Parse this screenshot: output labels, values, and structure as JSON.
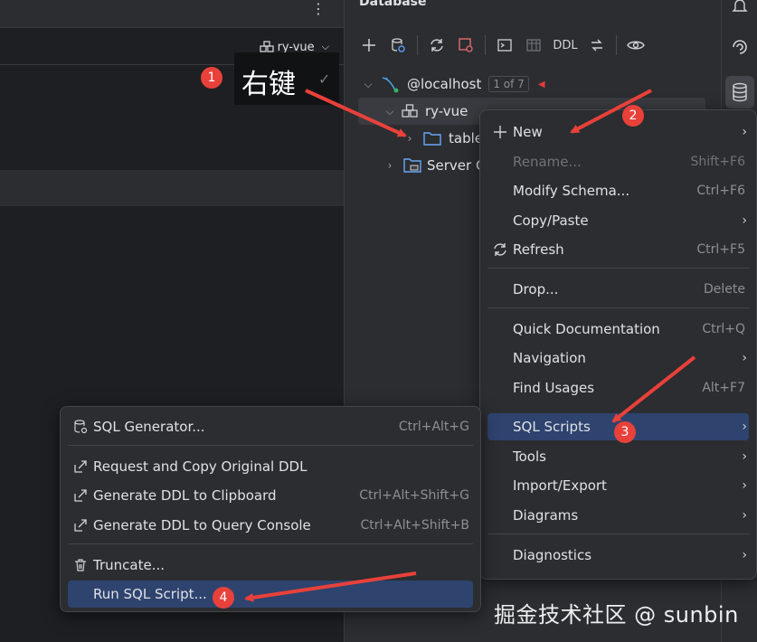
{
  "left": {
    "schema_label": "ry-vue",
    "dots": "⋮"
  },
  "db_panel": {
    "title": "Database",
    "toolbar": {
      "ddl_label": "DDL"
    }
  },
  "tree": {
    "host": "@localhost",
    "host_count": "1 of 7",
    "schema": "ry-vue",
    "tables": "table",
    "server": "Server C"
  },
  "main_menu": {
    "items": [
      {
        "label": "New",
        "shortcut": "",
        "submenu": true,
        "disabled": false
      },
      {
        "label": "Rename...",
        "shortcut": "Shift+F6",
        "submenu": false,
        "disabled": true
      },
      {
        "label": "Modify Schema...",
        "shortcut": "Ctrl+F6",
        "submenu": false,
        "disabled": false
      },
      {
        "label": "Copy/Paste",
        "shortcut": "",
        "submenu": true,
        "disabled": false
      },
      {
        "label": "Refresh",
        "shortcut": "Ctrl+F5",
        "submenu": false,
        "disabled": false
      },
      {
        "label": "Drop...",
        "shortcut": "Delete",
        "submenu": false,
        "disabled": false
      },
      {
        "label": "Quick Documentation",
        "shortcut": "Ctrl+Q",
        "submenu": false,
        "disabled": false
      },
      {
        "label": "Navigation",
        "shortcut": "",
        "submenu": true,
        "disabled": false
      },
      {
        "label": "Find Usages",
        "shortcut": "Alt+F7",
        "submenu": false,
        "disabled": false
      },
      {
        "label": "SQL Scripts",
        "shortcut": "",
        "submenu": true,
        "disabled": false
      },
      {
        "label": "Tools",
        "shortcut": "",
        "submenu": true,
        "disabled": false
      },
      {
        "label": "Import/Export",
        "shortcut": "",
        "submenu": true,
        "disabled": false
      },
      {
        "label": "Diagrams",
        "shortcut": "",
        "submenu": true,
        "disabled": false
      },
      {
        "label": "Diagnostics",
        "shortcut": "",
        "submenu": true,
        "disabled": false
      }
    ]
  },
  "sub_menu": {
    "items": [
      {
        "label": "SQL Generator...",
        "shortcut": "Ctrl+Alt+G"
      },
      {
        "label": "Request and Copy Original DDL",
        "shortcut": ""
      },
      {
        "label": "Generate DDL to Clipboard",
        "shortcut": "Ctrl+Alt+Shift+G"
      },
      {
        "label": "Generate DDL to Query Console",
        "shortcut": "Ctrl+Alt+Shift+B"
      },
      {
        "label": "Truncate...",
        "shortcut": ""
      },
      {
        "label": "Run SQL Script...",
        "shortcut": ""
      }
    ]
  },
  "annotations": {
    "callout_text": "右键",
    "badges": [
      "1",
      "2",
      "3",
      "4"
    ],
    "color": "#e8413a"
  },
  "watermark": "掘金技术社区 @ sunbin",
  "colors": {
    "active_item": "#2e436e",
    "panel_bg": "#2b2d30",
    "editor_bg": "#1e1f22"
  }
}
